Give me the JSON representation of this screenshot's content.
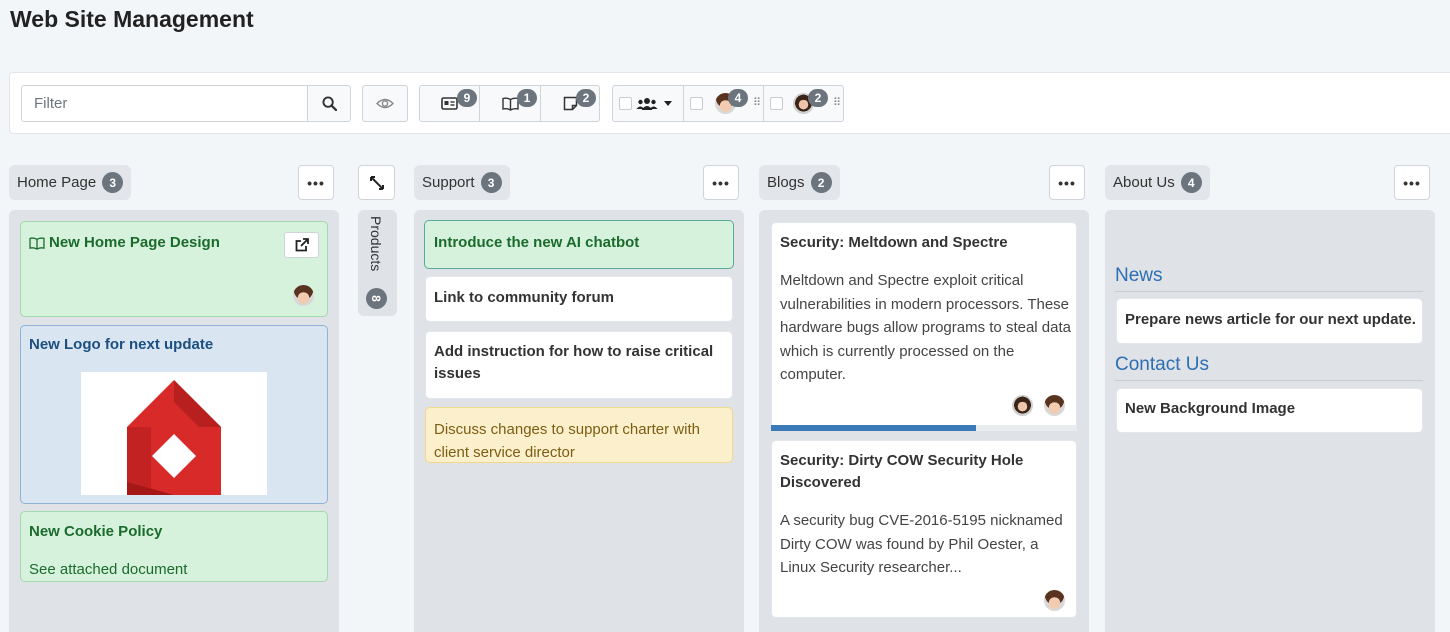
{
  "app": {
    "title": "Web Site Management"
  },
  "toolbar": {
    "filter_placeholder": "Filter",
    "type_counts": {
      "cards": "9",
      "book": "1",
      "note": "2"
    },
    "users": [
      {
        "name": "user-man",
        "count": "4"
      },
      {
        "name": "user-woman",
        "count": "2"
      }
    ]
  },
  "columns": {
    "home": {
      "title": "Home Page",
      "count": "3",
      "cards": [
        {
          "title": "New Home Page Design"
        },
        {
          "title": "New Logo for next update"
        },
        {
          "title": "New Cookie Policy",
          "body": "See attached document"
        }
      ]
    },
    "products": {
      "title": "Products",
      "count": "8"
    },
    "support": {
      "title": "Support",
      "count": "3",
      "cards": [
        {
          "title": "Introduce the new AI chatbot"
        },
        {
          "title": "Link to community forum"
        },
        {
          "title": "Add instruction for how to raise critical issues"
        },
        {
          "title": "Discuss changes to support charter with client service director"
        }
      ]
    },
    "blogs": {
      "title": "Blogs",
      "count": "2",
      "progress_fraction": 0.67,
      "cards": [
        {
          "title": "Security: Meltdown and Spectre",
          "body": "Meltdown and Spectre exploit critical vulnerabilities in modern processors. These hardware bugs allow programs to steal data which is currently processed on the computer."
        },
        {
          "title": "Security: Dirty COW Security Hole Discovered",
          "body": "A security bug CVE-2016-5195 nicknamed Dirty COW was found by Phil Oester, a Linux Security researcher..."
        }
      ]
    },
    "about": {
      "title": "About Us",
      "count": "4",
      "sections": [
        {
          "heading": "News",
          "cards": [
            {
              "title": "Prepare news article for our next update."
            }
          ]
        },
        {
          "heading": "Contact Us",
          "cards": [
            {
              "title": "New Background Image"
            }
          ]
        }
      ]
    }
  },
  "colors": {
    "accent": "#2d6fb3",
    "badge": "#6c757d",
    "progress": "#3a7ab8"
  }
}
